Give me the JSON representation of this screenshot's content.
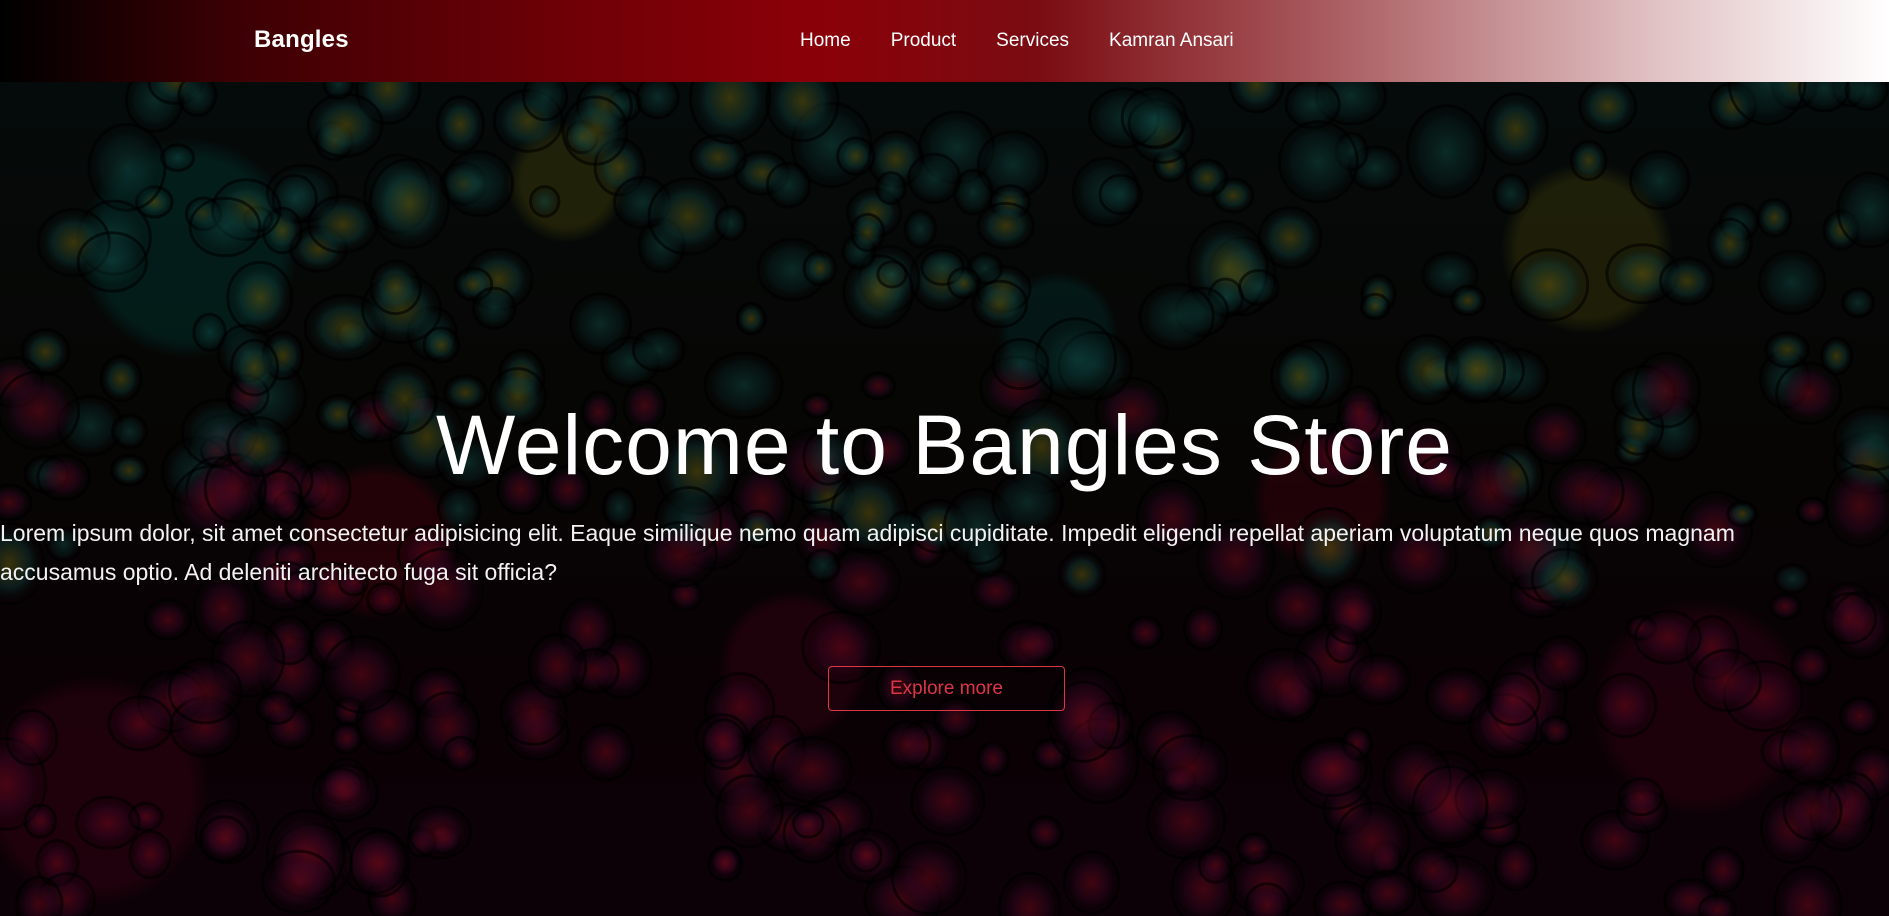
{
  "navbar": {
    "brand": "Bangles",
    "links": [
      "Home",
      "Product",
      "Services",
      "Kamran Ansari"
    ]
  },
  "hero": {
    "title": "Welcome to Bangles Store",
    "text": "Lorem ipsum dolor, sit amet consectetur adipisicing elit. Eaque similique nemo quam adipisci cupiditate. Impedit eligendi repellat aperiam voluptatum neque quos magnam accusamus optio. Ad deleniti architecto fuga sit officia?",
    "button_label": "Explore more"
  },
  "colors": {
    "navbar_gradient": [
      "#000000",
      "#8b0008",
      "#ffffff"
    ],
    "button_accent": "#dc3545",
    "text": "#ffffff"
  }
}
